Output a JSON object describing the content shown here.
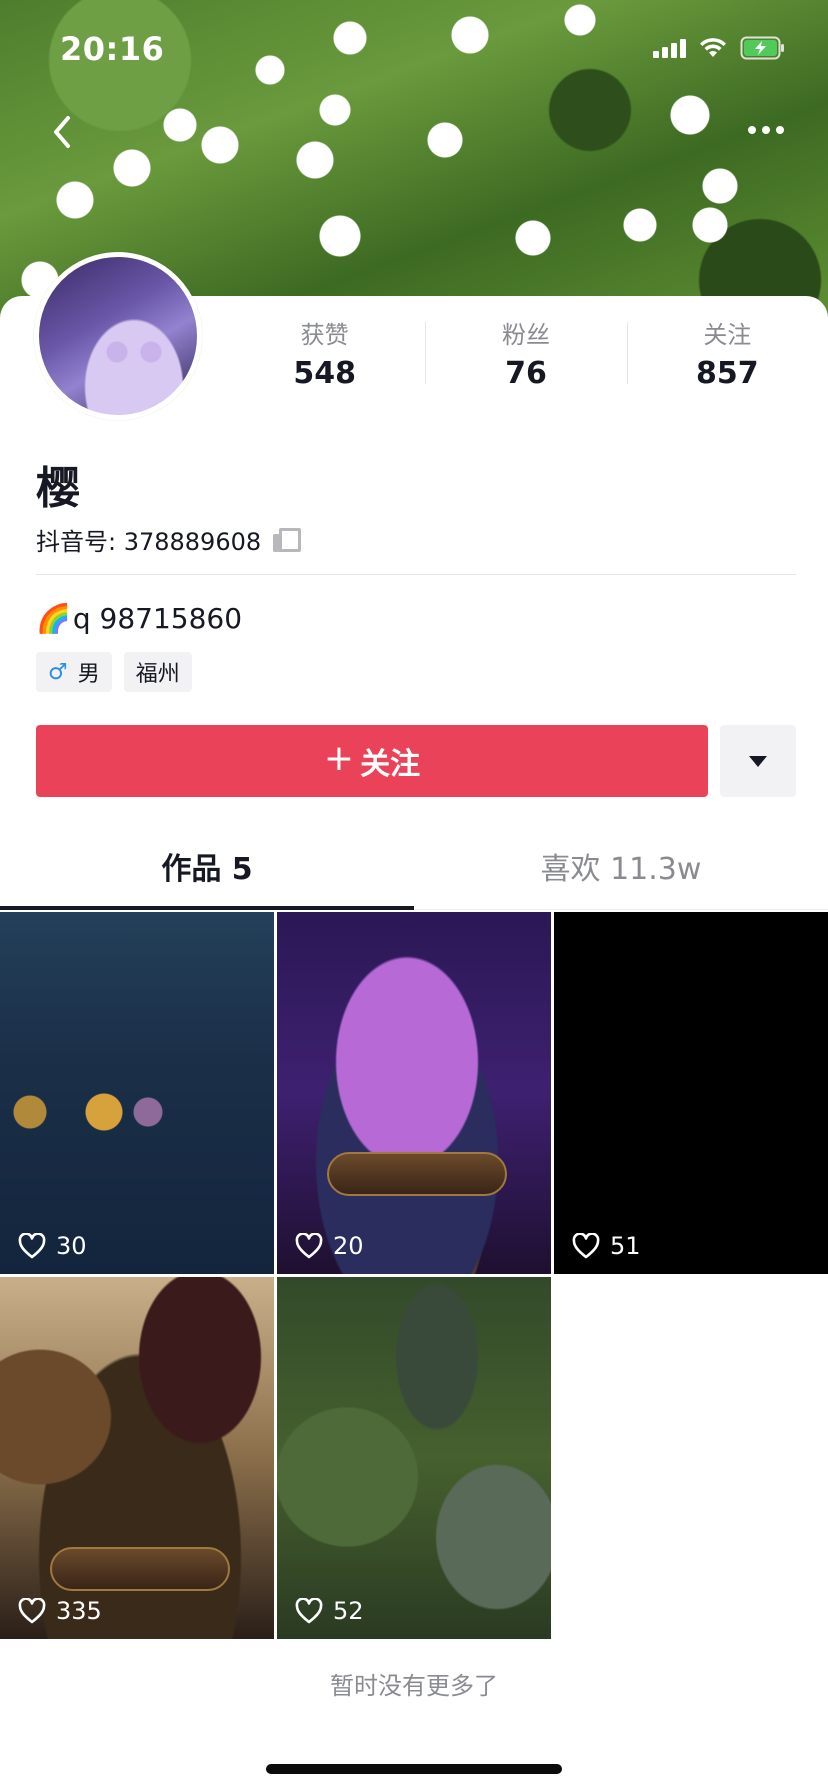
{
  "status_bar": {
    "time": "20:16"
  },
  "profile": {
    "name": "樱",
    "douyin_id_label": "抖音号: 378889608",
    "bio": "q 98715860",
    "bio_emoji": "🌈",
    "tags": [
      {
        "icon": "male-icon",
        "label": "男"
      },
      {
        "label": "福州"
      }
    ],
    "stats": [
      {
        "label": "获赞",
        "value": "548"
      },
      {
        "label": "粉丝",
        "value": "76"
      },
      {
        "label": "关注",
        "value": "857"
      }
    ]
  },
  "actions": {
    "follow_label": "关注",
    "follow_color": "#EA4359"
  },
  "tabs": [
    {
      "label": "作品 5",
      "active": true
    },
    {
      "label": "喜欢 11.3w",
      "active": false
    }
  ],
  "videos": [
    {
      "likes": "30"
    },
    {
      "likes": "20"
    },
    {
      "likes": "51"
    },
    {
      "likes": "335"
    },
    {
      "likes": "52"
    }
  ],
  "footer": {
    "end_text": "暂时没有更多了"
  }
}
